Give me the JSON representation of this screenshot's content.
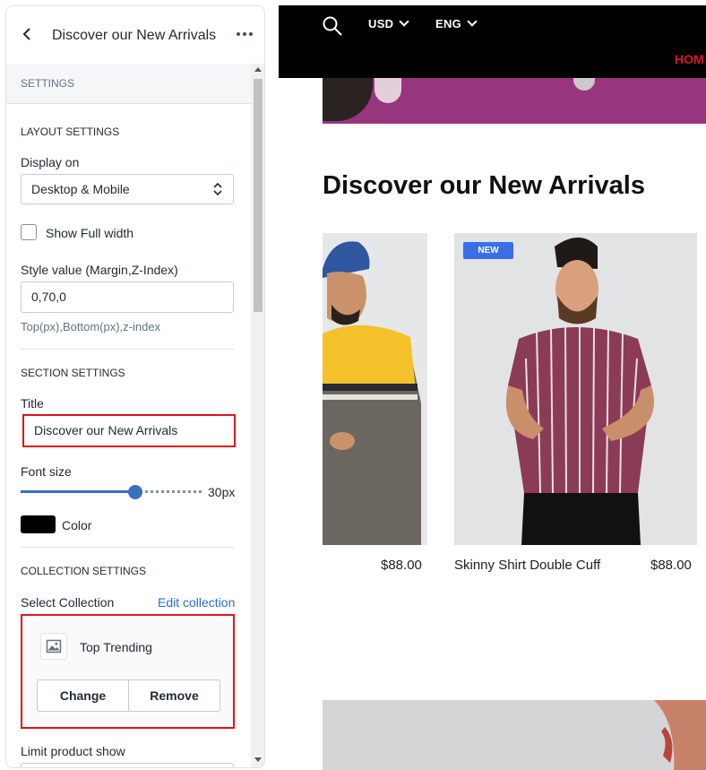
{
  "panel": {
    "title": "Discover our New Arrivals",
    "settings_label": "SETTINGS",
    "layout": {
      "heading": "LAYOUT SETTINGS",
      "display_on_label": "Display on",
      "display_on_value": "Desktop & Mobile",
      "full_width_label": "Show Full width",
      "style_label": "Style value (Margin,Z-Index)",
      "style_value": "0,70,0",
      "style_help": "Top(px),Bottom(px),z-index"
    },
    "section": {
      "heading": "SECTION SETTINGS",
      "title_label": "Title",
      "title_value": "Discover our New Arrivals",
      "font_size_label": "Font size",
      "font_size_value": "30px",
      "font_size_fraction": 0.58,
      "color_label": "Color",
      "color_value": "#000000"
    },
    "collection": {
      "heading": "COLLECTION SETTINGS",
      "select_label": "Select Collection",
      "edit_link": "Edit collection",
      "name": "Top Trending",
      "change_button": "Change",
      "remove_button": "Remove",
      "limit_label": "Limit product show"
    }
  },
  "store": {
    "currency": "USD",
    "language": "ENG",
    "nav_home": "HOM",
    "section_title": "Discover our New Arrivals",
    "products": [
      {
        "name": "",
        "price": "$88.00",
        "badge": ""
      },
      {
        "name": "Skinny Shirt Double Cuff",
        "price": "$88.00",
        "badge": "NEW"
      }
    ]
  },
  "colors": {
    "accent_blue": "#3a6ebf",
    "highlight_red": "#e0141e",
    "badge_blue": "#3a6ee8",
    "nav_red": "#e0141e",
    "banner_purple": "#97367e"
  },
  "icons": [
    "back-arrow-icon",
    "more-dots-icon",
    "select-arrows-icon",
    "image-placeholder-icon",
    "search-icon",
    "chevron-down-icon"
  ]
}
